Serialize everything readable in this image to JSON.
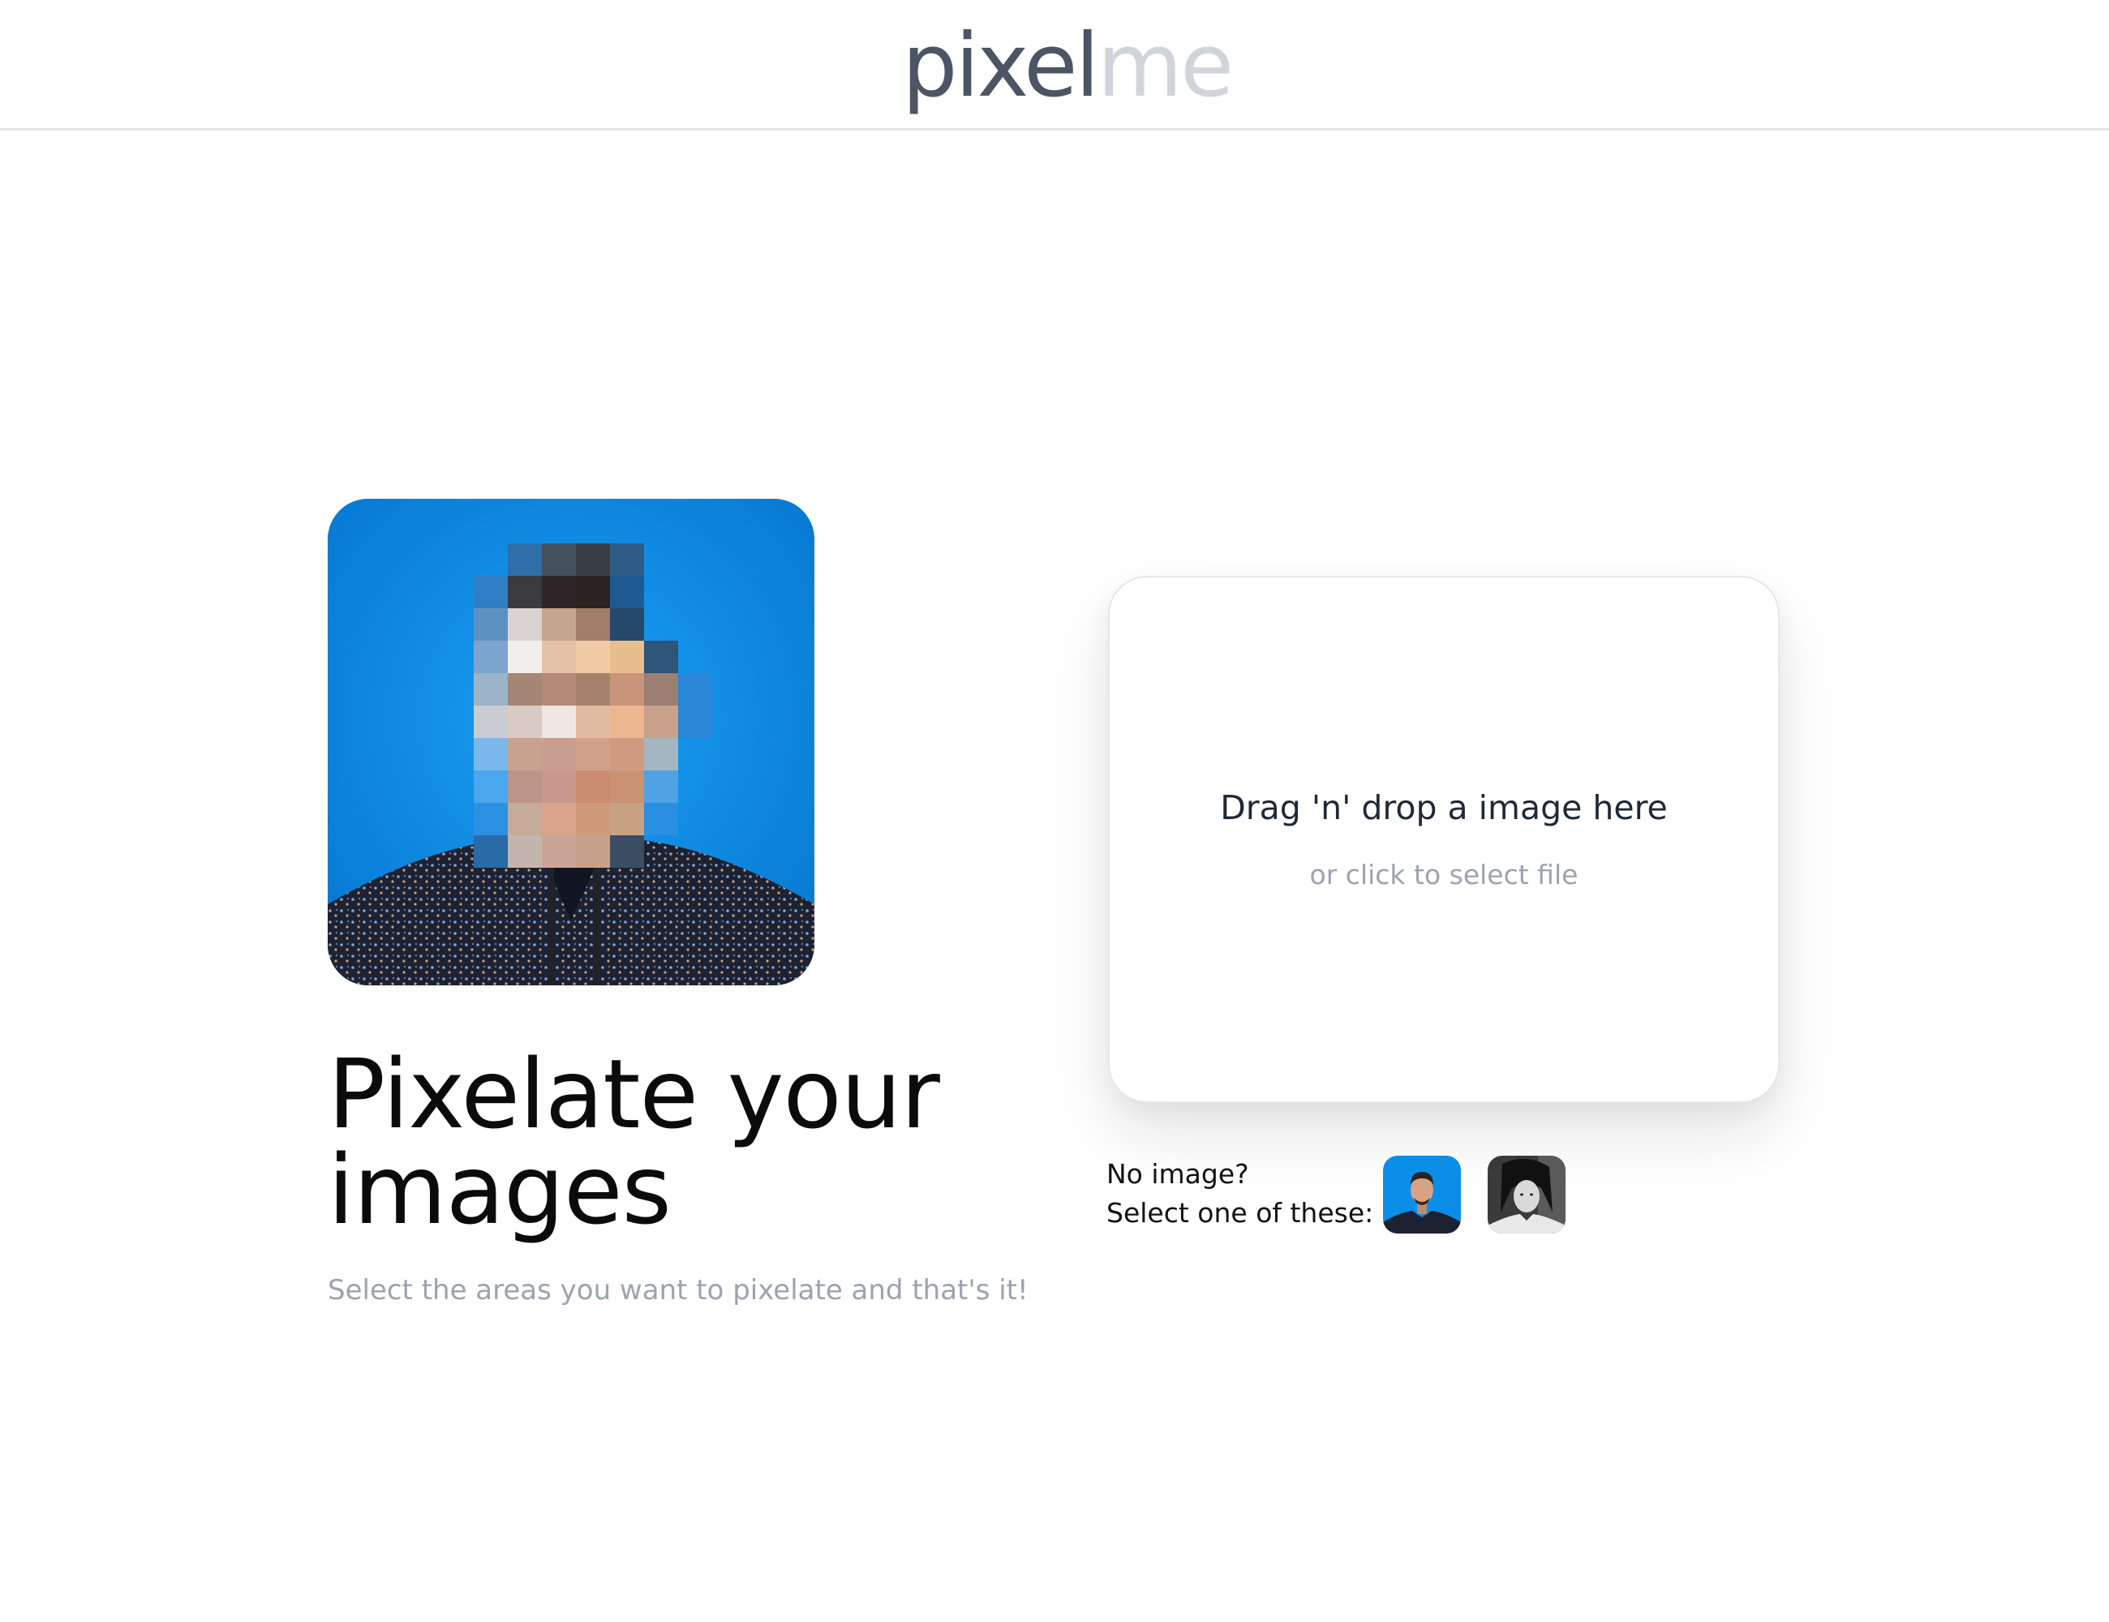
{
  "header": {
    "logo_part1": "pixel",
    "logo_part2": "me"
  },
  "hero": {
    "title_line1": "Pixelate your",
    "title_line2": "images",
    "subtitle": "Select the areas you want to pixelate and that's it!"
  },
  "dropzone": {
    "title": "Drag 'n' drop a image here",
    "subtitle": "or click to select file"
  },
  "samples": {
    "label_line1": "No image?",
    "label_line2": "Select one of these:"
  },
  "colors": {
    "logo_dark": "#4b5563",
    "logo_light": "#d1d5db",
    "photo_background": "#0a8ee8"
  }
}
